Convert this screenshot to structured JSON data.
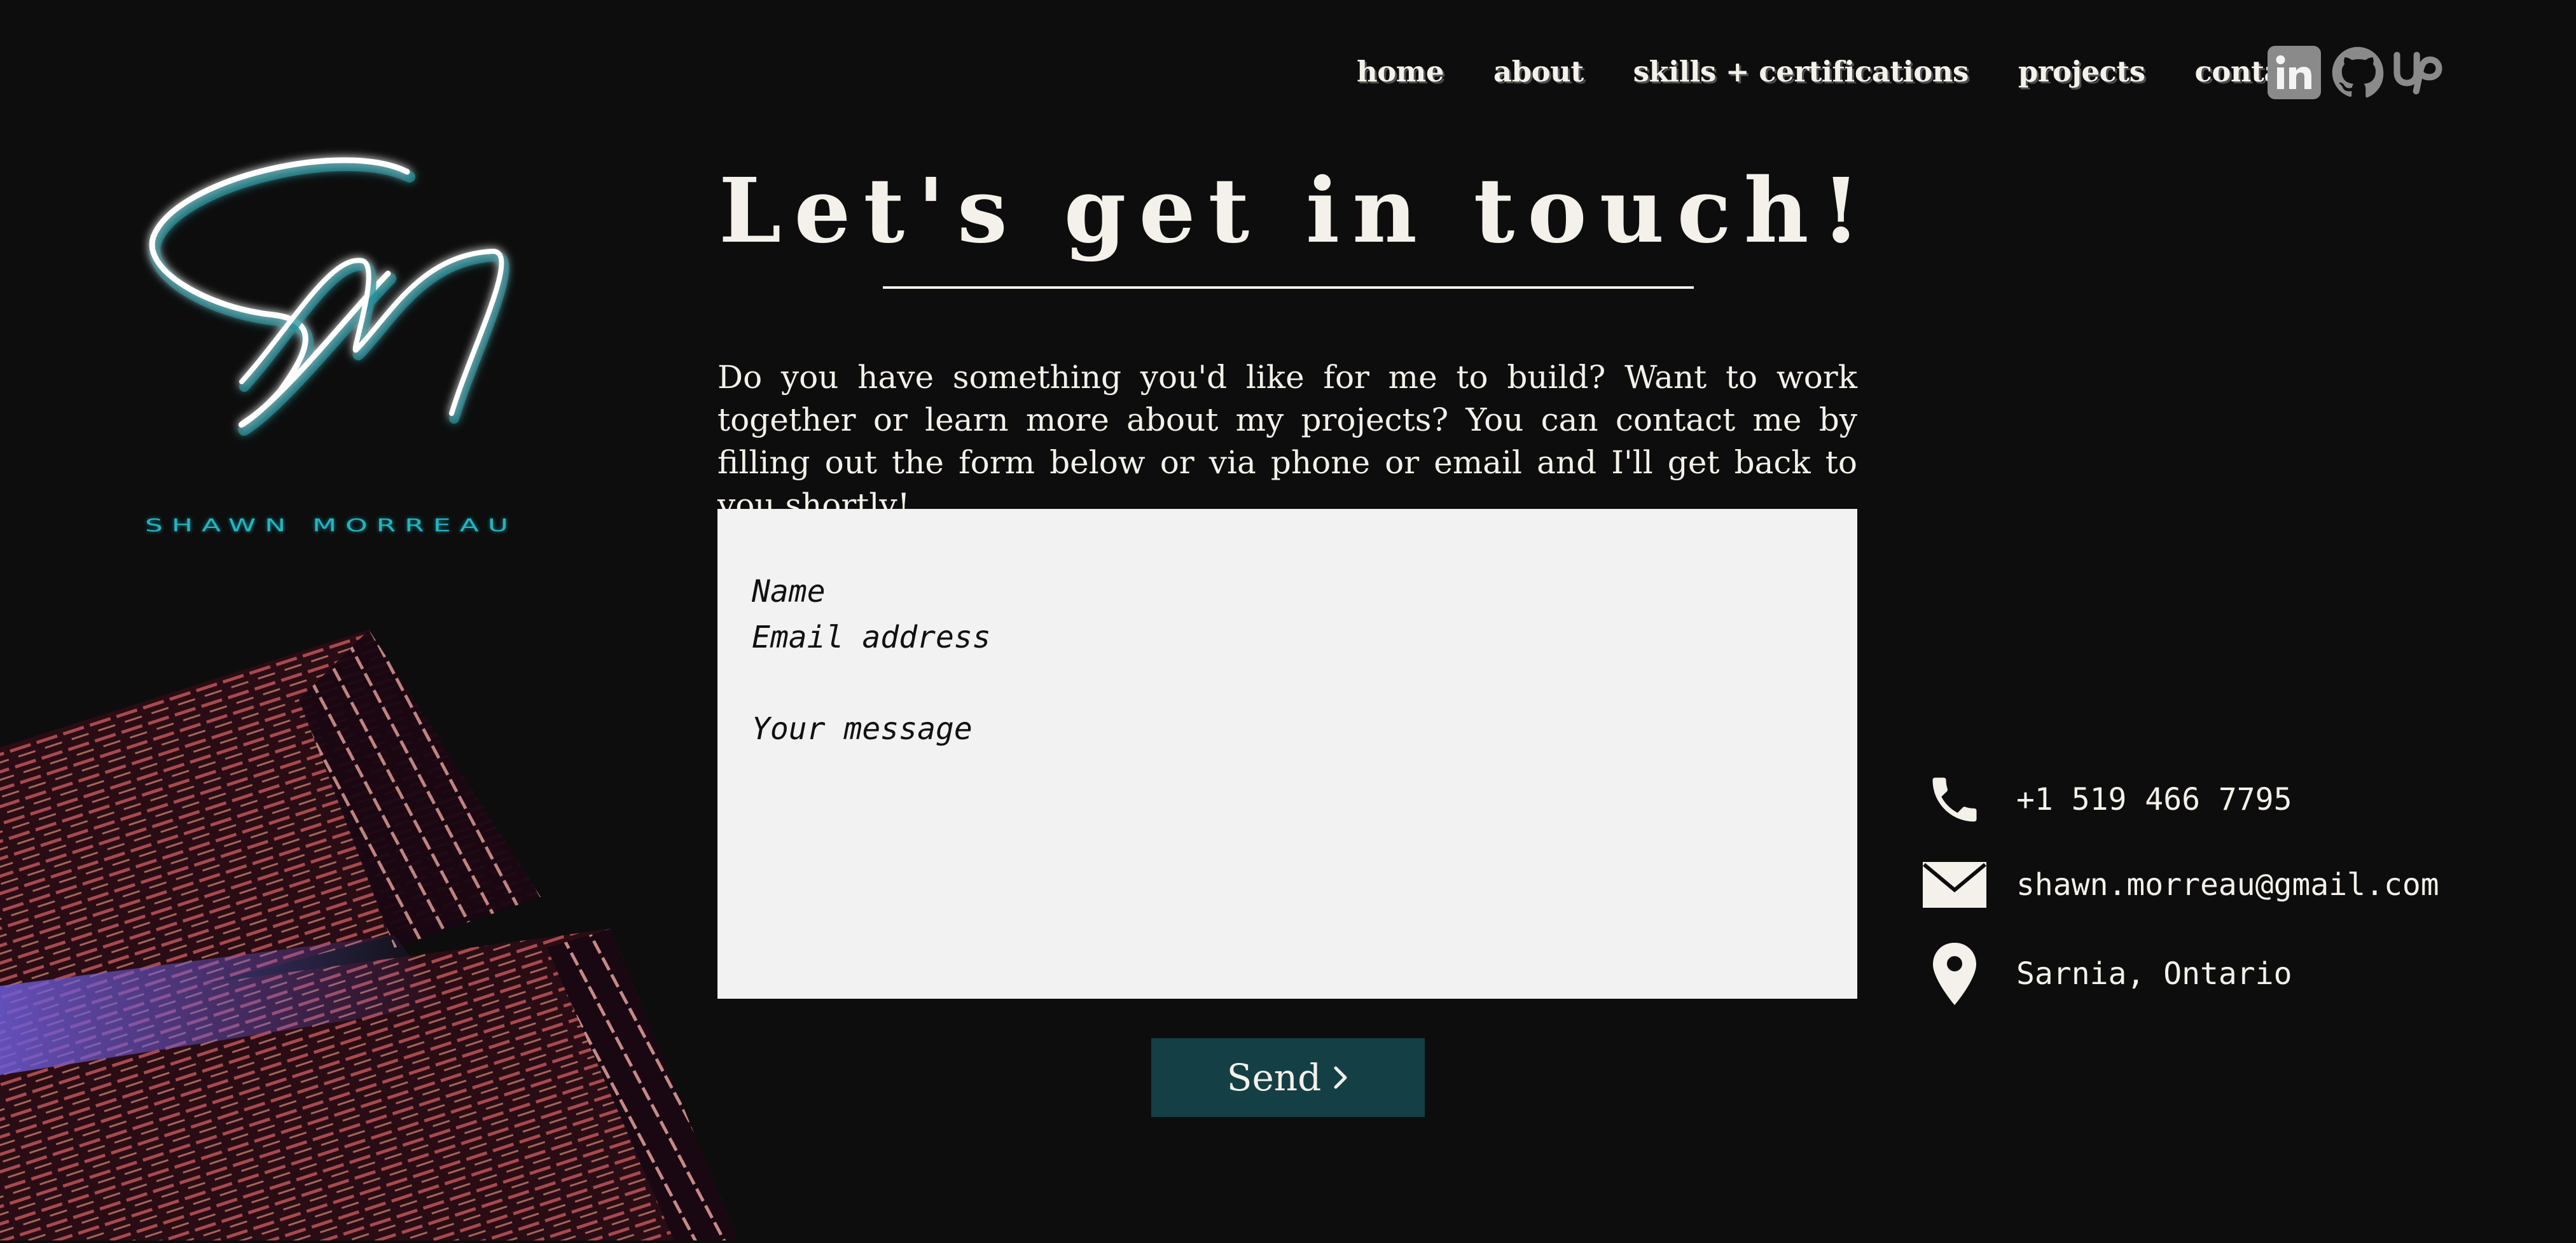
{
  "nav": {
    "items": [
      {
        "label": "home"
      },
      {
        "label": "about"
      },
      {
        "label": "skills + certifications"
      },
      {
        "label": "projects"
      },
      {
        "label": "contact"
      }
    ],
    "socials": [
      "linkedin-icon",
      "github-icon",
      "upwork-icon"
    ]
  },
  "brand": {
    "monogram": "SM",
    "name": "SHAWN MORREAU",
    "accent_color": "#21b6c2"
  },
  "contact": {
    "title": "Let's get in touch!",
    "intro": "Do you have something you'd like for me to build? Want to work together or learn more about my projects? You can contact me by filling out the form below or via phone or email and I'll get back to you shortly!",
    "form": {
      "name_placeholder": "Name",
      "email_placeholder": "Email address",
      "message_placeholder": "Your message",
      "send_label": "Send"
    },
    "info": {
      "phone": "+1 519 466 7795",
      "email": "shawn.morreau@gmail.com",
      "location": "Sarnia, Ontario"
    }
  },
  "colors": {
    "background": "#0d0d0d",
    "text": "#f4f1ea",
    "button": "#143f45",
    "form_bg": "#f2f2f2"
  }
}
